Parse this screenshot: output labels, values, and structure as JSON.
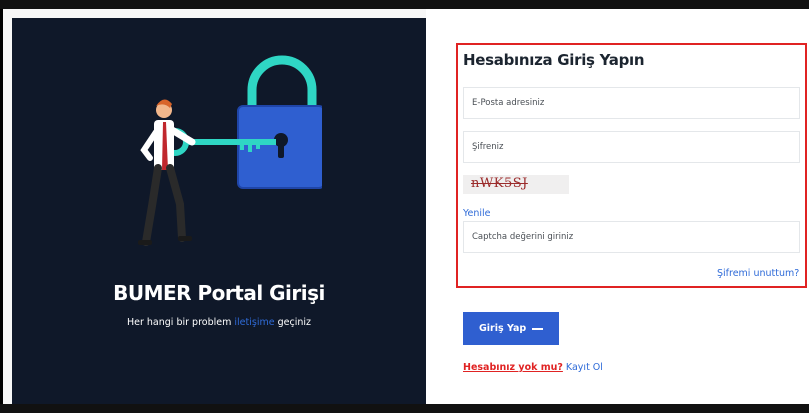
{
  "left": {
    "title": "BUMER Portal Girişi",
    "subtitle_before": "Her hangi bir problem ",
    "subtitle_link": "iletişime",
    "subtitle_after": " geçiniz",
    "illustration": "man-with-key-and-padlock"
  },
  "login": {
    "title": "Hesabınıza Giriş Yapın",
    "email_placeholder": "E-Posta adresiniz",
    "password_placeholder": "Şifreniz",
    "captcha_text": "nWK5SJ",
    "refresh_label": "Yenile",
    "captcha_placeholder": "Captcha değerini giriniz",
    "forgot_label": "Şifremi unuttum?",
    "submit_label": "Giriş Yap",
    "no_account_label": "Hesabınız yok mu?",
    "register_label": "Kayıt Ol"
  },
  "colors": {
    "dark_panel": "#0f1829",
    "accent_blue": "#2f5fd0",
    "highlight_red": "#e02323",
    "lock_teal": "#2fd6c4"
  }
}
